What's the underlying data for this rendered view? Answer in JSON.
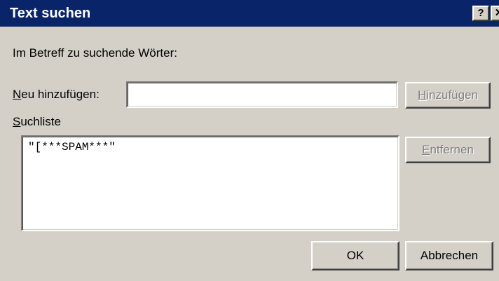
{
  "window": {
    "title": "Text suchen",
    "help_label": "?",
    "close_label": "✕"
  },
  "dialog": {
    "instruction": "Im Betreff zu suchende Wörter:",
    "add_label": {
      "accel": "N",
      "rest": "eu hinzufügen:"
    },
    "add_input_value": "",
    "add_button": {
      "accel": "H",
      "rest": "inzufügen"
    },
    "list_label": {
      "accel": "S",
      "rest": "uchliste"
    },
    "list_items": [
      "\"[***SPAM***\""
    ],
    "remove_button": {
      "accel": "E",
      "rest": "ntfernen"
    },
    "ok_button": "OK",
    "cancel_button": "Abbrechen"
  }
}
